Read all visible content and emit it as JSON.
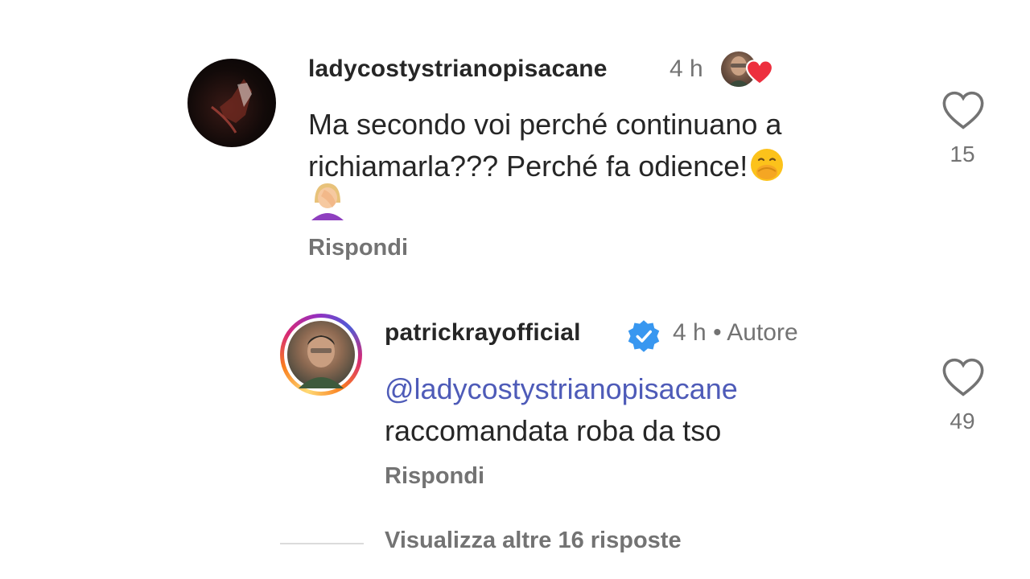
{
  "comments": [
    {
      "username": "ladycostystrianopisacane",
      "time": "4 h",
      "text": "Ma secondo voi perché continuano a richiamarla??? Perché fa odience!",
      "reply_label": "Rispondi",
      "likes": "15",
      "icons": [
        "avatar",
        "liked-by-author-avatar",
        "heart-icon",
        "face-with-hand-over-mouth-emoji",
        "woman-facepalming-emoji"
      ]
    },
    {
      "username": "patrickrayofficial",
      "time": "4 h",
      "separator": "•",
      "author_tag": "Autore",
      "mention": "@ladycostystrianopisacane",
      "text": "raccomandata roba da tso",
      "reply_label": "Rispondi",
      "likes": "49",
      "icons": [
        "avatar-with-story-ring",
        "verified-badge-icon",
        "heart-icon"
      ]
    }
  ],
  "more_replies": "Visualizza altre 16 risposte",
  "colors": {
    "text": "#262626",
    "secondary": "#737373",
    "mention": "#4e5bb8",
    "verified": "#3897f0",
    "heart_red": "#ed2f3e"
  }
}
